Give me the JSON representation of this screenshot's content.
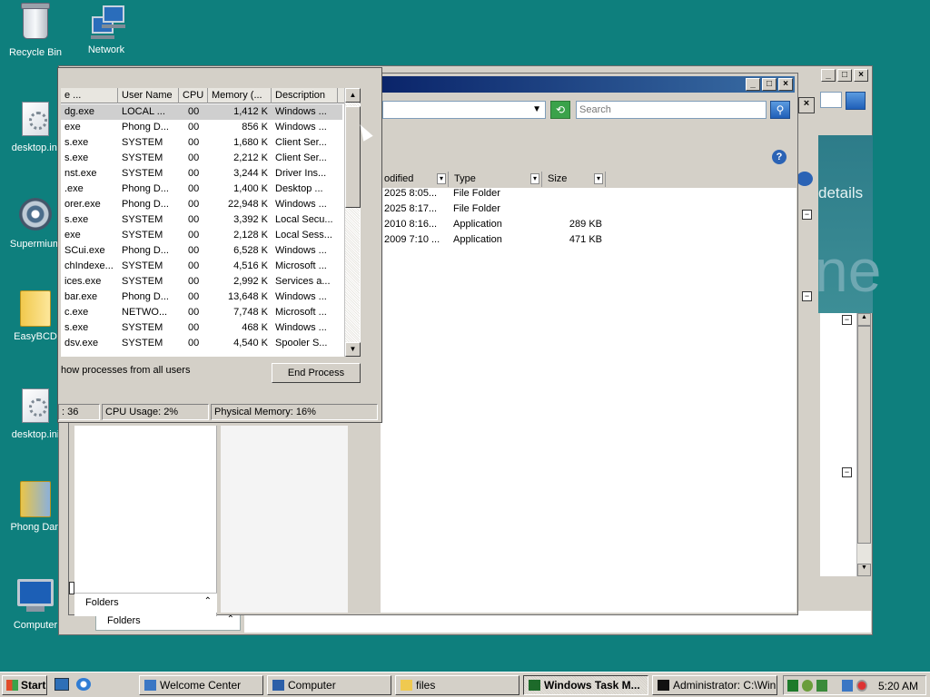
{
  "desktop": {
    "icons": [
      {
        "label": "Recycle Bin",
        "icon": "recycle-bin-icon"
      },
      {
        "label": "Network",
        "icon": "network-icon"
      },
      {
        "label": "desktop.ini",
        "icon": "config-file-icon"
      },
      {
        "label": "Supermium",
        "icon": "browser-icon"
      },
      {
        "label": "EasyBCD",
        "icon": "folder-icon"
      },
      {
        "label": "desktop.ini",
        "icon": "config-file-icon"
      },
      {
        "label": "Phong Dan",
        "icon": "user-folder-icon"
      },
      {
        "label": "Computer",
        "icon": "computer-icon"
      }
    ]
  },
  "back_window": {
    "details_text": "details",
    "big_text": "ne",
    "folders_label": "Folders"
  },
  "explorer": {
    "search_placeholder": "Search",
    "columns": [
      {
        "label": "odified"
      },
      {
        "label": "Type"
      },
      {
        "label": "Size"
      }
    ],
    "files": [
      {
        "modified": "2025 8:05...",
        "type": "File Folder",
        "size": ""
      },
      {
        "modified": "2025 8:17...",
        "type": "File Folder",
        "size": ""
      },
      {
        "modified": "2010 8:16...",
        "type": "Application",
        "size": "289 KB"
      },
      {
        "modified": "2009 7:10 ...",
        "type": "Application",
        "size": "471 KB"
      }
    ],
    "folders_label": "Folders"
  },
  "task_manager": {
    "columns": [
      "e ...",
      "User Name",
      "CPU",
      "Memory (...",
      "Description"
    ],
    "processes": [
      {
        "name": "dg.exe",
        "user": "LOCAL ...",
        "cpu": "00",
        "mem": "1,412 K",
        "desc": "Windows ...",
        "selected": true
      },
      {
        "name": "exe",
        "user": "Phong D...",
        "cpu": "00",
        "mem": "856 K",
        "desc": "Windows ..."
      },
      {
        "name": "s.exe",
        "user": "SYSTEM",
        "cpu": "00",
        "mem": "1,680 K",
        "desc": "Client Ser..."
      },
      {
        "name": "s.exe",
        "user": "SYSTEM",
        "cpu": "00",
        "mem": "2,212 K",
        "desc": "Client Ser..."
      },
      {
        "name": "nst.exe",
        "user": "SYSTEM",
        "cpu": "00",
        "mem": "3,244 K",
        "desc": "Driver Ins..."
      },
      {
        "name": ".exe",
        "user": "Phong D...",
        "cpu": "00",
        "mem": "1,400 K",
        "desc": "Desktop ..."
      },
      {
        "name": "orer.exe",
        "user": "Phong D...",
        "cpu": "00",
        "mem": "22,948 K",
        "desc": "Windows ..."
      },
      {
        "name": "s.exe",
        "user": "SYSTEM",
        "cpu": "00",
        "mem": "3,392 K",
        "desc": "Local Secu..."
      },
      {
        "name": "exe",
        "user": "SYSTEM",
        "cpu": "00",
        "mem": "2,128 K",
        "desc": "Local Sess..."
      },
      {
        "name": "SCui.exe",
        "user": "Phong D...",
        "cpu": "00",
        "mem": "6,528 K",
        "desc": "Windows ..."
      },
      {
        "name": "chIndexe...",
        "user": "SYSTEM",
        "cpu": "00",
        "mem": "4,516 K",
        "desc": "Microsoft ..."
      },
      {
        "name": "ices.exe",
        "user": "SYSTEM",
        "cpu": "00",
        "mem": "2,992 K",
        "desc": "Services a..."
      },
      {
        "name": "bar.exe",
        "user": "Phong D...",
        "cpu": "00",
        "mem": "13,648 K",
        "desc": "Windows ..."
      },
      {
        "name": "c.exe",
        "user": "NETWO...",
        "cpu": "00",
        "mem": "7,748 K",
        "desc": "Microsoft ..."
      },
      {
        "name": "s.exe",
        "user": "SYSTEM",
        "cpu": "00",
        "mem": "468 K",
        "desc": "Windows ..."
      },
      {
        "name": "dsv.exe",
        "user": "SYSTEM",
        "cpu": "00",
        "mem": "4,540 K",
        "desc": "Spooler S..."
      }
    ],
    "show_all_label": "how processes from all users",
    "end_process_label": "End Process",
    "status": {
      "processes": ": 36",
      "cpu": "CPU Usage: 2%",
      "memory": "Physical Memory: 16%"
    }
  },
  "taskbar": {
    "start_label": "Start",
    "items": [
      {
        "label": "Welcome Center",
        "active": false
      },
      {
        "label": "Computer",
        "active": false
      },
      {
        "label": "files",
        "active": false
      },
      {
        "label": "Windows Task M...",
        "active": true
      },
      {
        "label": "Administrator: C:\\Win...",
        "active": false
      }
    ],
    "clock": "5:20 AM"
  }
}
